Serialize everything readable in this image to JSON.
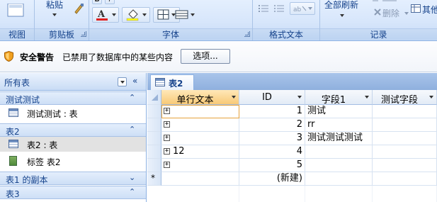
{
  "ribbon": {
    "groups": [
      {
        "label": "视图"
      },
      {
        "label": "剪贴板"
      },
      {
        "label": "字体"
      },
      {
        "label": "格式文本"
      },
      {
        "label": "记录"
      }
    ],
    "clipboard_paste": "粘贴",
    "records_refresh_all": "全部刷新",
    "records_delete": "删除",
    "records_other_partial": "其他"
  },
  "security_bar": {
    "title": "安全警告",
    "message": "已禁用了数据库中的某些内容",
    "options_button": "选项..."
  },
  "nav_pane": {
    "header": "所有表",
    "groups": [
      {
        "label": "测试测试",
        "chevron": "⌃",
        "items": [
          {
            "label": "测试测试 : 表",
            "icon": "table-icon"
          }
        ]
      },
      {
        "label": "表2",
        "chevron": "⌃",
        "items": [
          {
            "label": "表2 : 表",
            "icon": "table-icon",
            "selected": true
          },
          {
            "label": "标签 表2",
            "icon": "report-icon"
          }
        ]
      },
      {
        "label": "表1 的副本",
        "chevron": "⌄",
        "items": []
      },
      {
        "label": "表3",
        "chevron": "⌃",
        "items": []
      }
    ]
  },
  "document": {
    "tab_label": "表2",
    "columns": [
      "单行文本",
      "ID",
      "字段1",
      "测试字段"
    ],
    "rows": [
      {
        "单行文本": "",
        "ID": "1",
        "字段1": "测试",
        "测试字段": ""
      },
      {
        "单行文本": "",
        "ID": "2",
        "字段1": "rr",
        "测试字段": ""
      },
      {
        "单行文本": "",
        "ID": "3",
        "字段1": "测试测试测试",
        "测试字段": ""
      },
      {
        "单行文本": "12",
        "ID": "4",
        "字段1": "",
        "测试字段": ""
      },
      {
        "单行文本": "",
        "ID": "5",
        "字段1": "",
        "测试字段": ""
      }
    ],
    "new_row_marker": "*",
    "new_row_label": "(新建)"
  },
  "colors": {
    "ribbon_bg": "#d7e6fb",
    "accent": "#15428b",
    "active_header": "#f8c977",
    "nav_selected": "#e2e2e2"
  }
}
